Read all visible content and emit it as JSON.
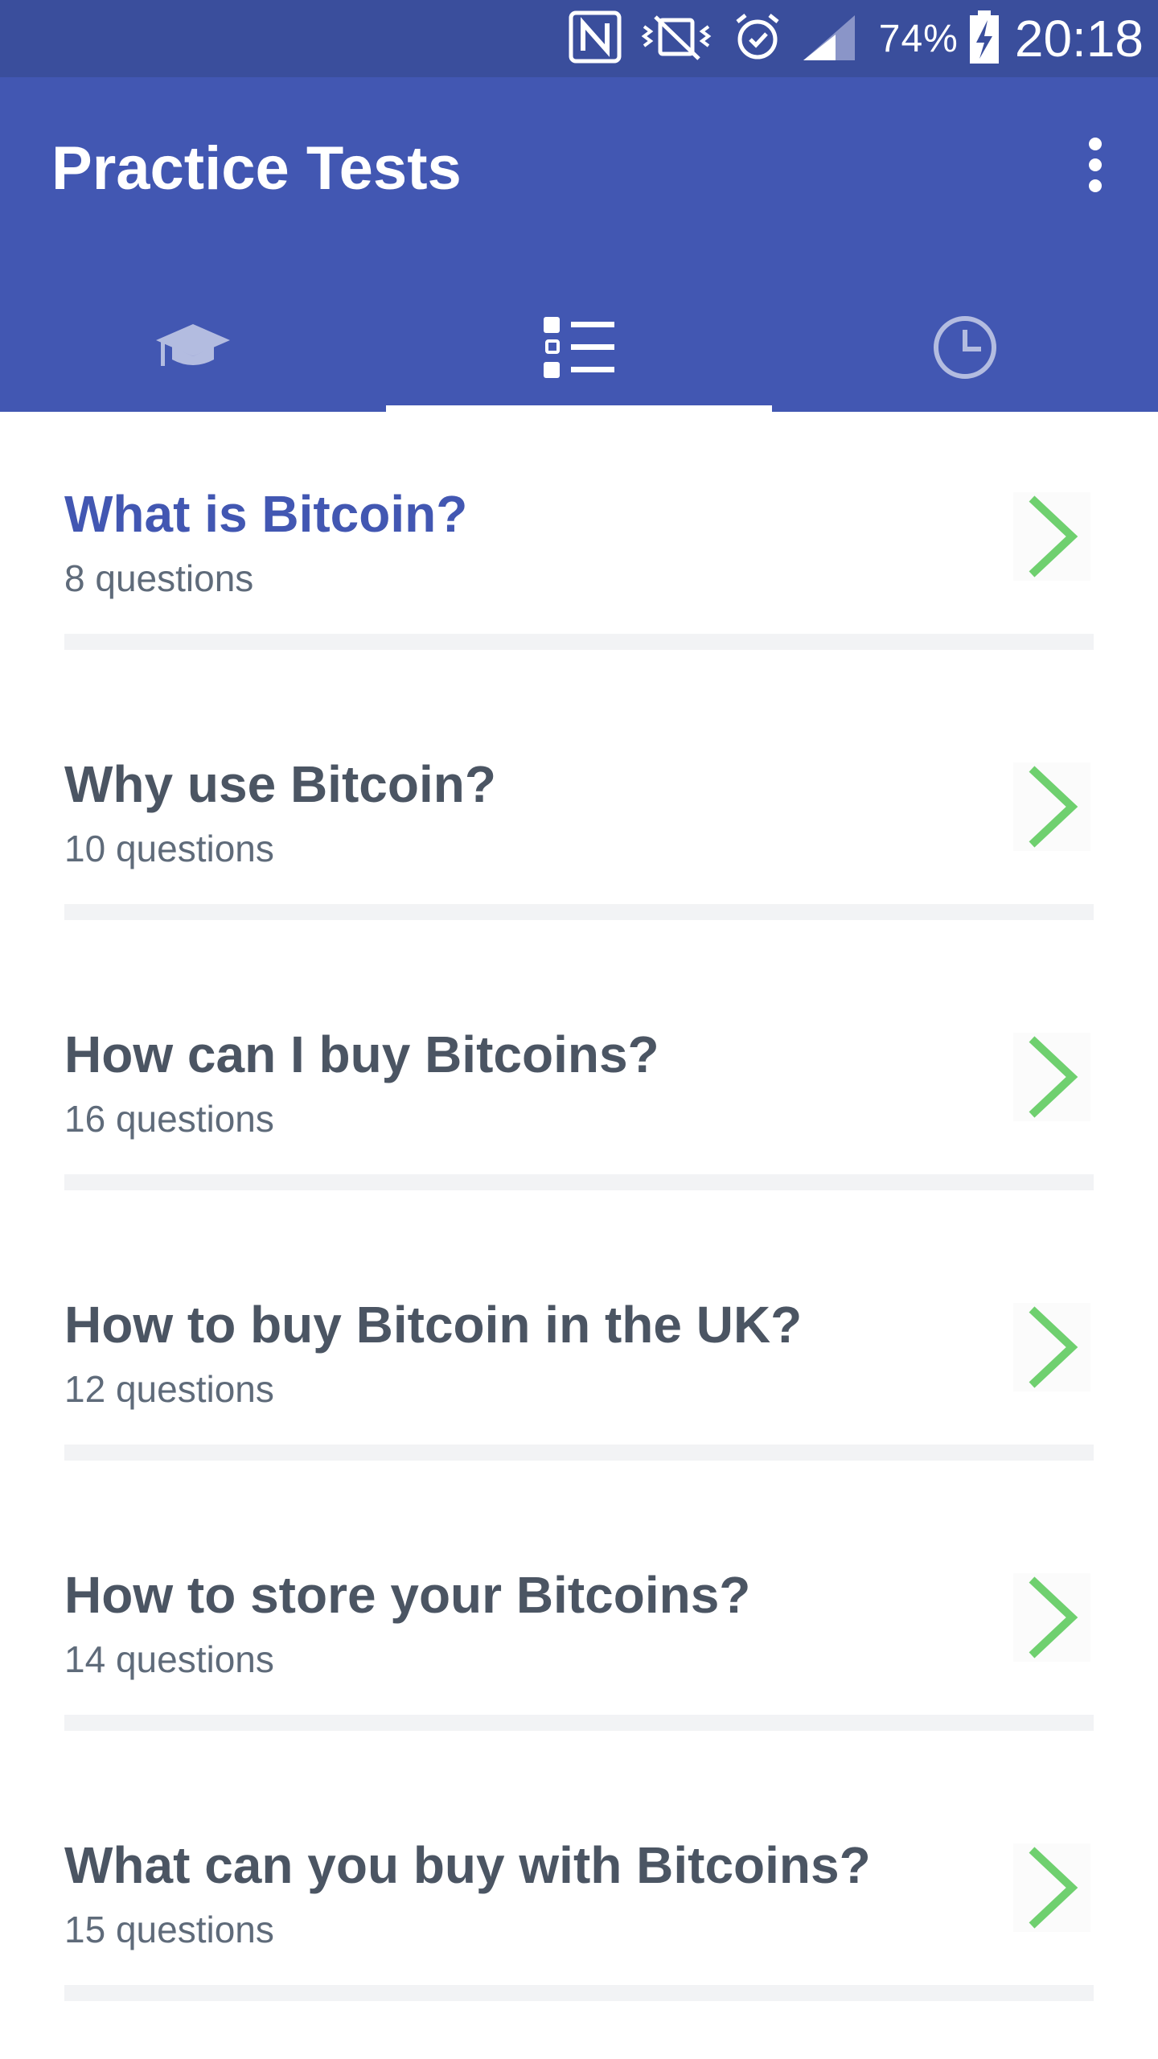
{
  "status_bar": {
    "battery_percent": "74%",
    "time": "20:18",
    "icons": [
      "nfc-icon",
      "vibrate-icon",
      "alarm-icon",
      "signal-icon",
      "battery-charging-icon"
    ]
  },
  "app_bar": {
    "title": "Practice Tests",
    "menu_icon": "overflow-menu-icon",
    "tabs": [
      {
        "icon": "graduation-cap-icon",
        "selected": false
      },
      {
        "icon": "list-icon",
        "selected": true
      },
      {
        "icon": "clock-icon",
        "selected": false
      }
    ]
  },
  "tests": [
    {
      "title": "What is Bitcoin?",
      "count": "8 questions"
    },
    {
      "title": "Why use Bitcoin?",
      "count": "10 questions"
    },
    {
      "title": "How can I buy Bitcoins?",
      "count": "16 questions"
    },
    {
      "title": "How to buy Bitcoin in the UK?",
      "count": "12 questions"
    },
    {
      "title": "How to store your Bitcoins?",
      "count": "14 questions"
    },
    {
      "title": "What can you buy with Bitcoins?",
      "count": "15 questions"
    }
  ],
  "colors": {
    "status_bar": "#3a4e9c",
    "app_bar": "#4257b2",
    "active_title": "#4257b2",
    "title": "#4b5563",
    "chevron": "#6fd06f"
  }
}
